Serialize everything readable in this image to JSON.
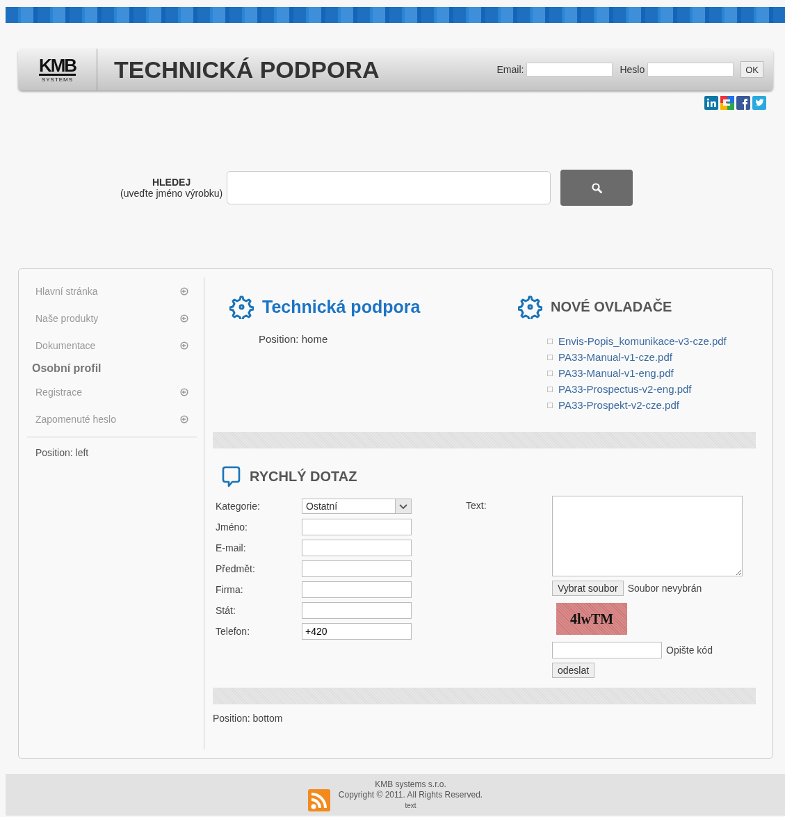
{
  "header": {
    "logo": "KMB",
    "logo_sub": "SYSTEMS",
    "title": "TECHNICKÁ PODPORA",
    "login": [
      {
        "label": "Email:"
      },
      {
        "label": "Heslo"
      }
    ],
    "ok_button": "OK"
  },
  "search": {
    "label": "HLEDEJ",
    "hint": "(uveďte jméno výrobku)"
  },
  "sidebar": {
    "items": [
      {
        "kind": "link",
        "label": "Hlavní stránka"
      },
      {
        "kind": "link",
        "label": "Naše produkty"
      },
      {
        "kind": "link",
        "label": "Dokumentace"
      },
      {
        "kind": "heading",
        "label": "Osobní profil"
      },
      {
        "kind": "link",
        "label": "Registrace"
      },
      {
        "kind": "link",
        "label": "Zapomenuté heslo"
      }
    ],
    "position": "Position: left"
  },
  "home": {
    "title": "Technická podpora",
    "position": "Position: home"
  },
  "drivers": {
    "title": "NOVÉ OVLADAČE",
    "files": [
      "Envis-Popis_komunikace-v3-cze.pdf",
      "PA33-Manual-v1-cze.pdf",
      "PA33-Manual-v1-eng.pdf",
      "PA33-Prospectus-v2-eng.pdf",
      "PA33-Prospekt-v2-cze.pdf"
    ]
  },
  "quick_query": {
    "title": "RYCHLÝ DOTAZ",
    "fields": [
      {
        "kind": "select",
        "label": "Kategorie:",
        "value": "Ostatní"
      },
      {
        "kind": "text",
        "label": "Jméno:"
      },
      {
        "kind": "text",
        "label": "E-mail:"
      },
      {
        "kind": "text",
        "label": "Předmět:"
      },
      {
        "kind": "text",
        "label": "Firma:"
      },
      {
        "kind": "text",
        "label": "Stát:"
      },
      {
        "kind": "text",
        "label": "Telefon:",
        "value": "+420"
      }
    ],
    "text_label": "Text:",
    "file_button": "Vybrat soubor",
    "file_status": "Soubor nevybrán",
    "captcha": "4lwTM",
    "captcha_label": "Opište kód",
    "submit": "odeslat"
  },
  "bottom": {
    "position": "Position: bottom"
  },
  "footer": {
    "lines": [
      "KMB systems s.r.o.",
      "Copyright © 2011. All Rights Reserved.",
      "text"
    ]
  }
}
